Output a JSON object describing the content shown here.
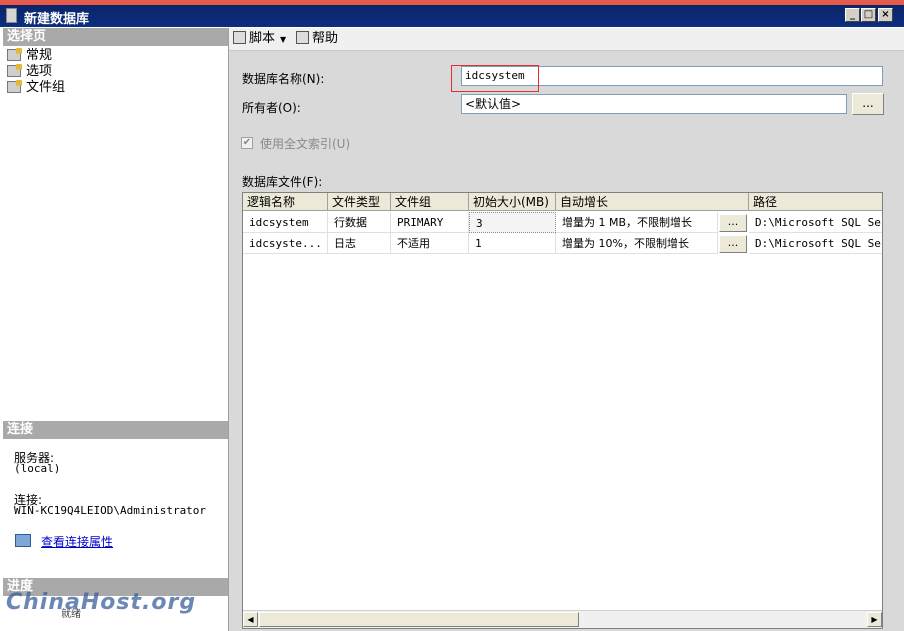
{
  "window": {
    "title": "新建数据库",
    "minimize": "_",
    "maximize": "□",
    "close": "×"
  },
  "left": {
    "select_page_header": "选择页",
    "pages": [
      {
        "label": "常规"
      },
      {
        "label": "选项"
      },
      {
        "label": "文件组"
      }
    ],
    "connection_header": "连接",
    "server_label": "服务器:",
    "server_value": "(local)",
    "connection_label": "连接:",
    "connection_value": "WIN-KC19Q4LEIOD\\Administrator",
    "view_props_link": "查看连接属性",
    "progress_header": "进度",
    "progress_status": "就绪"
  },
  "toolbar": {
    "script_label": "脚本",
    "help_label": "帮助"
  },
  "form": {
    "dbname_label": "数据库名称(N):",
    "dbname_value": "idcsystem",
    "owner_label": "所有者(O):",
    "owner_value": "<默认值>",
    "browse_label": "...",
    "fulltext_label": "使用全文索引(U)",
    "fulltext_checked": true,
    "files_label": "数据库文件(F):"
  },
  "grid": {
    "columns": [
      "逻辑名称",
      "文件类型",
      "文件组",
      "初始大小(MB)",
      "自动增长",
      "路径"
    ],
    "rows": [
      {
        "logical": "idcsystem",
        "type": "行数据",
        "group": "PRIMARY",
        "size": "3",
        "growth": "增量为 1 MB，不限制增长",
        "path": "D:\\Microsoft SQL Serv"
      },
      {
        "logical": "idcsyste...",
        "type": "日志",
        "group": "不适用",
        "size": "1",
        "growth": "增量为 10%，不限制增长",
        "path": "D:\\Microsoft SQL Serv"
      }
    ]
  },
  "watermark": "ChinaHost.org"
}
